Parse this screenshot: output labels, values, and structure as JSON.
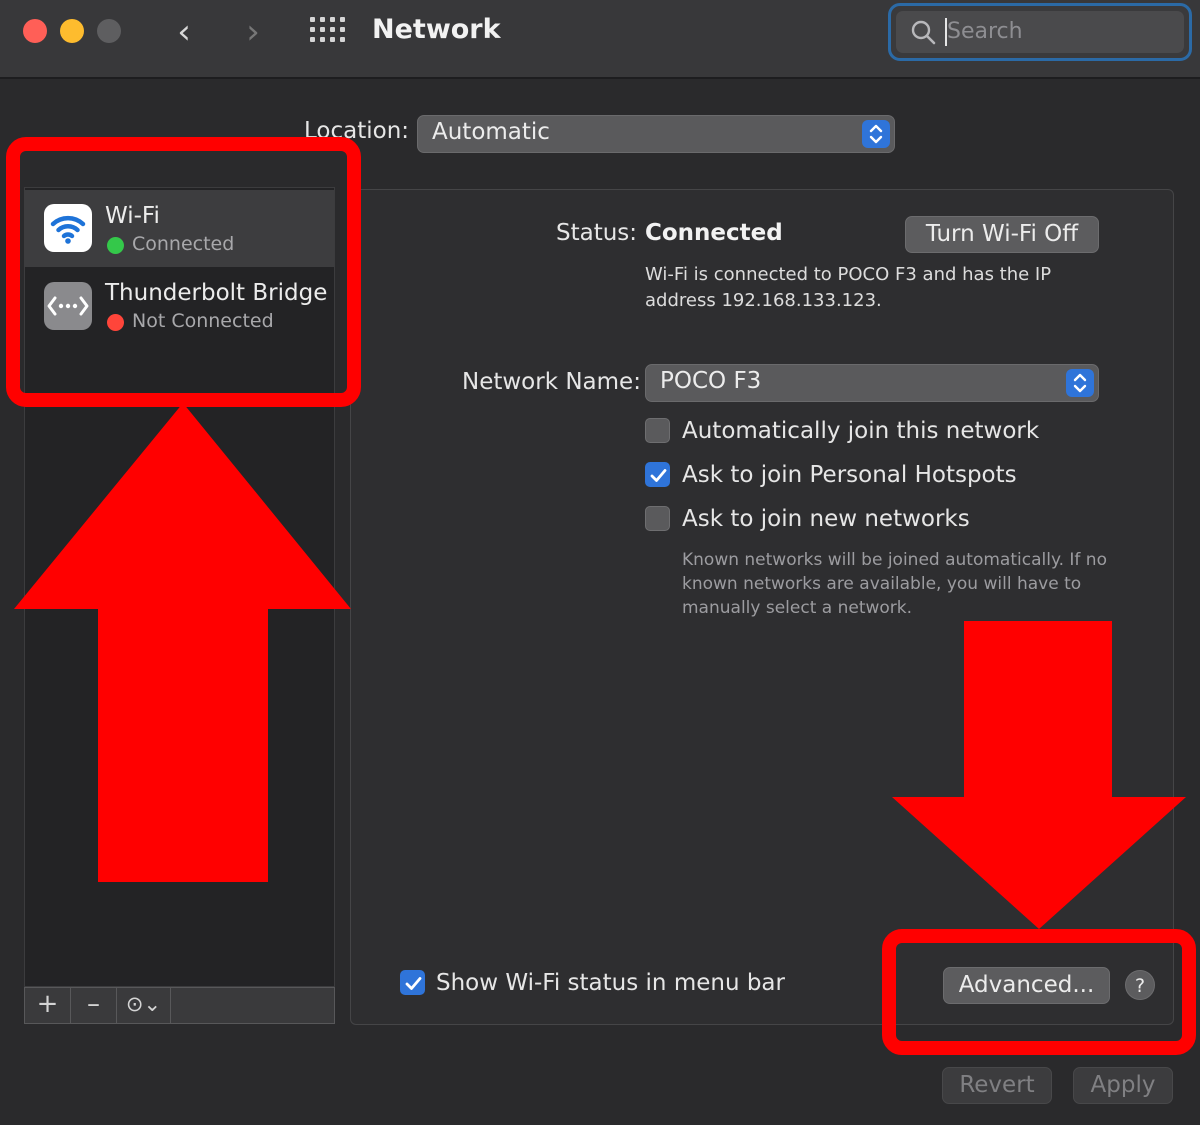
{
  "window": {
    "title": "Network",
    "back_glyph": "‹",
    "forward_glyph": "›"
  },
  "search": {
    "placeholder": "Search",
    "value": ""
  },
  "location": {
    "label": "Location:",
    "value": "Automatic"
  },
  "services": [
    {
      "name": "Wi-Fi",
      "status": "Connected",
      "status_color": "#34c84a",
      "icon": "wifi-icon",
      "selected": true
    },
    {
      "name": "Thunderbolt Bridge",
      "status": "Not Connected",
      "status_color": "#ff453a",
      "icon": "thunderbolt-bridge-icon",
      "selected": false
    }
  ],
  "sidebar_controls": {
    "add": "+",
    "remove": "–",
    "action": "⊙⌄"
  },
  "status": {
    "label": "Status:",
    "value": "Connected",
    "toggle_button": "Turn Wi-Fi Off",
    "description_line1": "Wi-Fi is connected to POCO F3 and has the IP",
    "description_line2": "address 192.168.133.123."
  },
  "network_name": {
    "label": "Network Name:",
    "value": "POCO F3"
  },
  "options": [
    {
      "label": "Automatically join this network",
      "checked": false
    },
    {
      "label": "Ask to join Personal Hotspots",
      "checked": true
    },
    {
      "label": "Ask to join new networks",
      "checked": false
    }
  ],
  "known_networks_note": {
    "line1": "Known networks will be joined automatically. If no",
    "line2": "known networks are available, you will have to",
    "line3": "manually select a network."
  },
  "show_status": {
    "label": "Show Wi-Fi status in menu bar",
    "checked": true
  },
  "buttons": {
    "advanced": "Advanced...",
    "help": "?",
    "revert": "Revert",
    "apply": "Apply"
  },
  "colors": {
    "accent": "#2f74d9",
    "annotation": "#ff0000",
    "search_focus": "#2b6aa6"
  }
}
